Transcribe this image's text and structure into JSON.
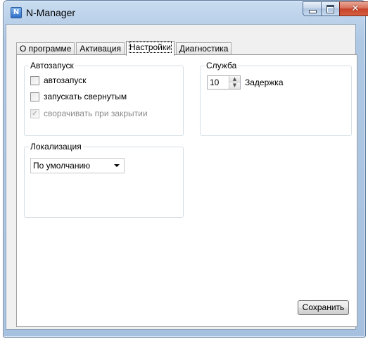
{
  "window": {
    "title": "N-Manager",
    "app_icon_glyph": "N"
  },
  "icons": {
    "minimize": "minimize-icon",
    "maximize": "maximize-icon",
    "close": "close-icon",
    "close_glyph": "✕"
  },
  "tabs": [
    {
      "label": "О программе",
      "active": false
    },
    {
      "label": "Активация",
      "active": false
    },
    {
      "label": "Настройки",
      "active": true
    },
    {
      "label": "Диагностика",
      "active": false
    }
  ],
  "autostart_group": {
    "legend": "Автозапуск",
    "options": [
      {
        "label": "автозапуск",
        "checked": false,
        "enabled": true
      },
      {
        "label": "запускать свернутым",
        "checked": false,
        "enabled": true
      },
      {
        "label": "сворачивать при закрытии",
        "checked": true,
        "enabled": false
      }
    ]
  },
  "service_group": {
    "legend": "Служба",
    "delay_value": "10",
    "delay_label": "Задержка"
  },
  "localization_group": {
    "legend": "Локализация",
    "selected": "По умолчанию"
  },
  "save_button": "Сохранить",
  "colors": {
    "title_bar": "#b8cfe8",
    "close_button": "#c7432b",
    "panel_background": "#ffffff",
    "client_background": "#f0f0f0"
  }
}
